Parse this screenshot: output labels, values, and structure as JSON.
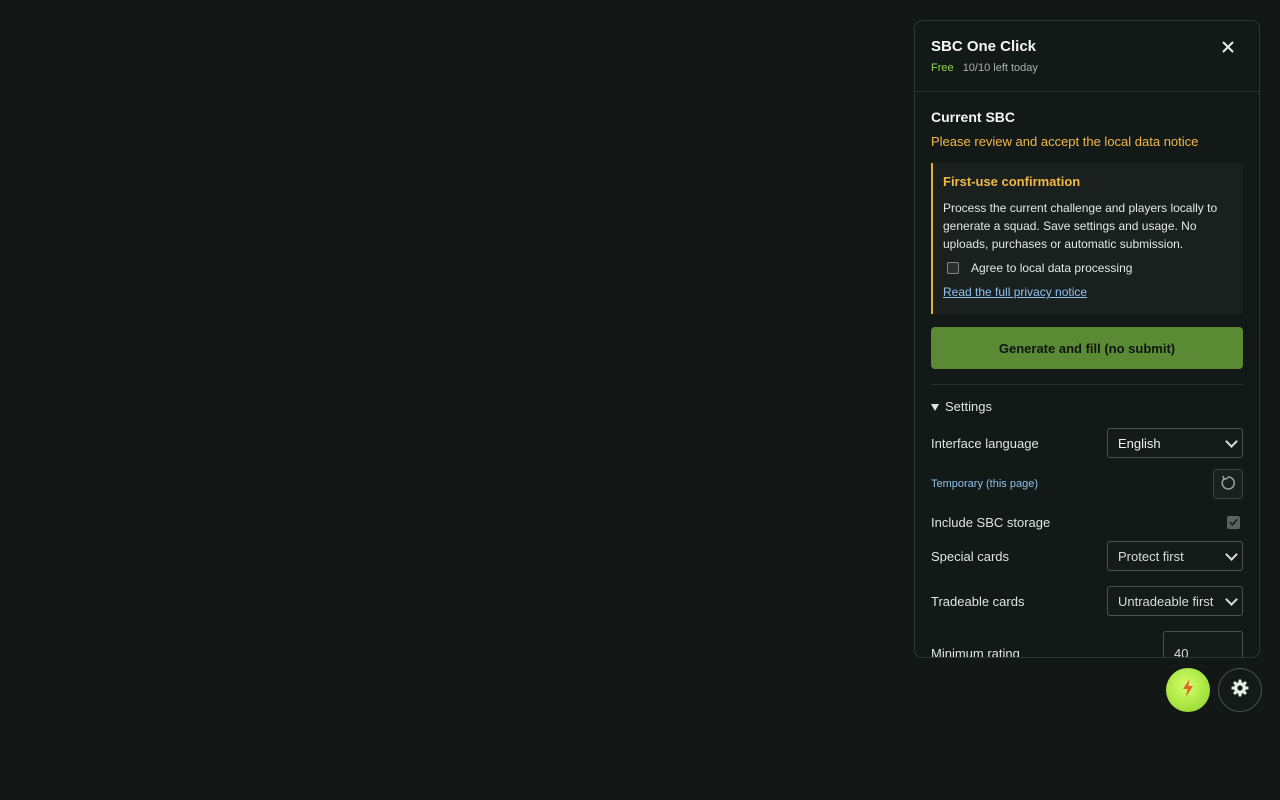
{
  "panel": {
    "title": "SBC One Click",
    "plan": "Free",
    "usage": "10/10 left today"
  },
  "current": {
    "title": "Current SBC",
    "notice": "Please review and accept the local data notice"
  },
  "confirmation": {
    "title": "First-use confirmation",
    "text": "Process the current challenge and players locally to generate a squad. Save settings and usage. No uploads, purchases or automatic submission.",
    "agree_label": "Agree to local data processing",
    "agree_checked": false,
    "privacy_link": "Read the full privacy notice"
  },
  "primary_button": "Generate and fill (no submit)",
  "settings": {
    "toggle_label": "Settings",
    "language_label": "Interface language",
    "language_value": "English",
    "temporary_label": "Temporary (this page)",
    "storage_label": "Include SBC storage",
    "storage_checked": true,
    "special_label": "Special cards",
    "special_value": "Protect first",
    "tradeable_label": "Tradeable cards",
    "tradeable_value": "Untradeable first",
    "min_rating_label": "Minimum rating",
    "min_rating_value": "40"
  },
  "colors": {
    "accent_green": "#5a8a33",
    "warning_orange": "#f2b84a",
    "link_blue": "#8fc1ee"
  },
  "icons": {
    "close": "close-icon",
    "reset": "reset-icon",
    "lightning": "lightning-icon",
    "gear": "gear-icon"
  }
}
